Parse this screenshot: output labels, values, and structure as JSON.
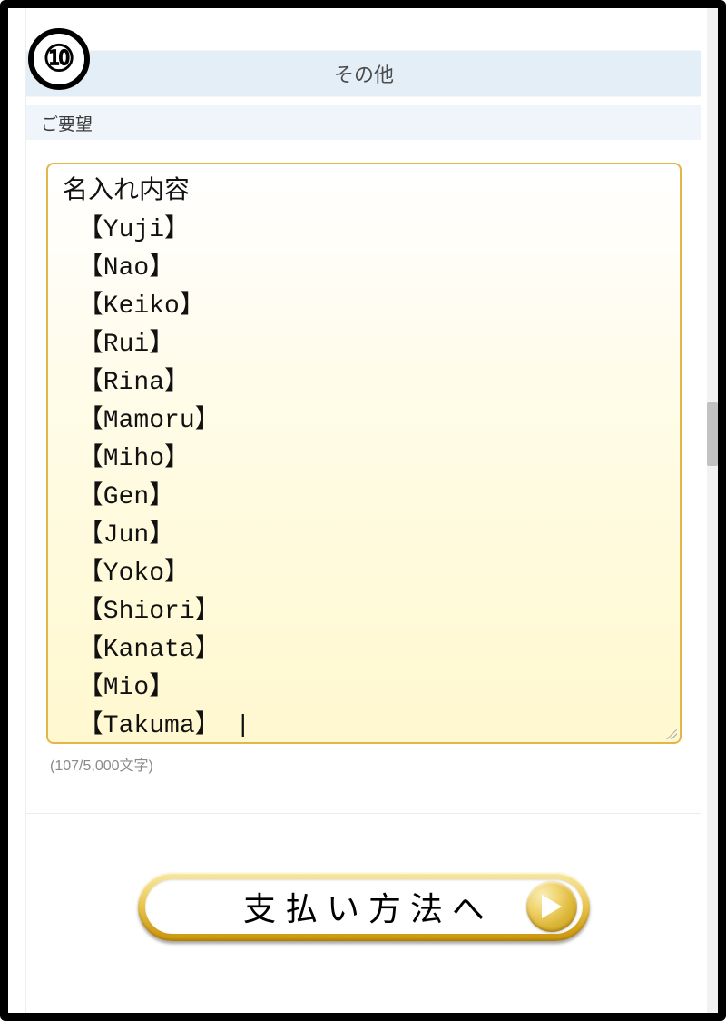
{
  "step_number": "⑩",
  "section_header": "その他",
  "sub_header": "ご要望",
  "textarea_value": "名入れ内容\n 【Yuji】\n 【Nao】\n 【Keiko】\n 【Rui】\n 【Rina】\n 【Mamoru】\n 【Miho】\n 【Gen】\n 【Jun】\n 【Yoko】\n 【Shiori】\n 【Kanata】\n 【Mio】\n 【Takuma】 |",
  "counter_text": "(107/5,000文字)",
  "button_label": "支払い方法へ"
}
